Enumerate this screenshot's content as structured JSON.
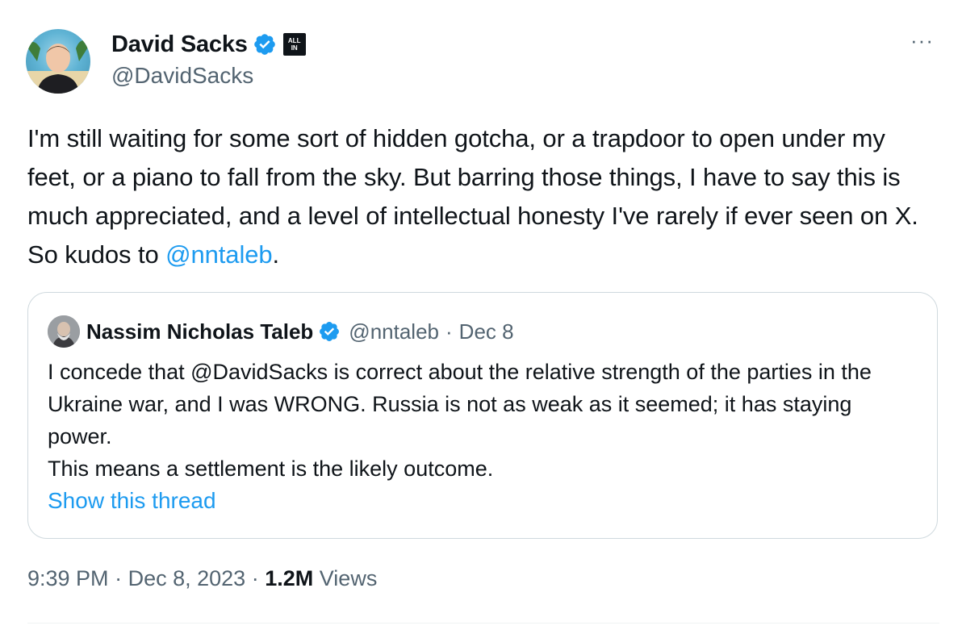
{
  "author": {
    "display_name": "David Sacks",
    "handle": "@DavidSacks",
    "affiliate_badge": "ALL IN"
  },
  "icons": {
    "verified": "verified-badge-icon",
    "more": "more-options-icon",
    "affiliate": "all-in-affiliate-icon"
  },
  "more_label": "···",
  "tweet": {
    "text_before": "I'm still waiting for some sort of hidden gotcha, or a trapdoor to open under my feet, or a piano to fall from the sky. But barring those things, I have to say this is much appreciated, and a level of intellectual honesty I've rarely if ever seen on X. So kudos to ",
    "mention": "@nntaleb",
    "text_after": "."
  },
  "quote": {
    "display_name": "Nassim Nicholas Taleb",
    "handle": "@nntaleb",
    "separator": "·",
    "date": "Dec 8",
    "text": "I concede that @DavidSacks is correct about the relative strength of the parties in the Ukraine war, and I was WRONG.  Russia is not as weak as it seemed; it has staying power.\nThis means a settlement is the likely outcome.",
    "show_thread": "Show this thread"
  },
  "meta": {
    "time": "9:39 PM",
    "separator": "·",
    "date": "Dec 8, 2023",
    "views_count": "1.2M",
    "views_label": "Views"
  },
  "colors": {
    "link": "#1d9bf0",
    "secondary_text": "#536471",
    "primary_text": "#0f1419",
    "border": "#cfd9de"
  }
}
